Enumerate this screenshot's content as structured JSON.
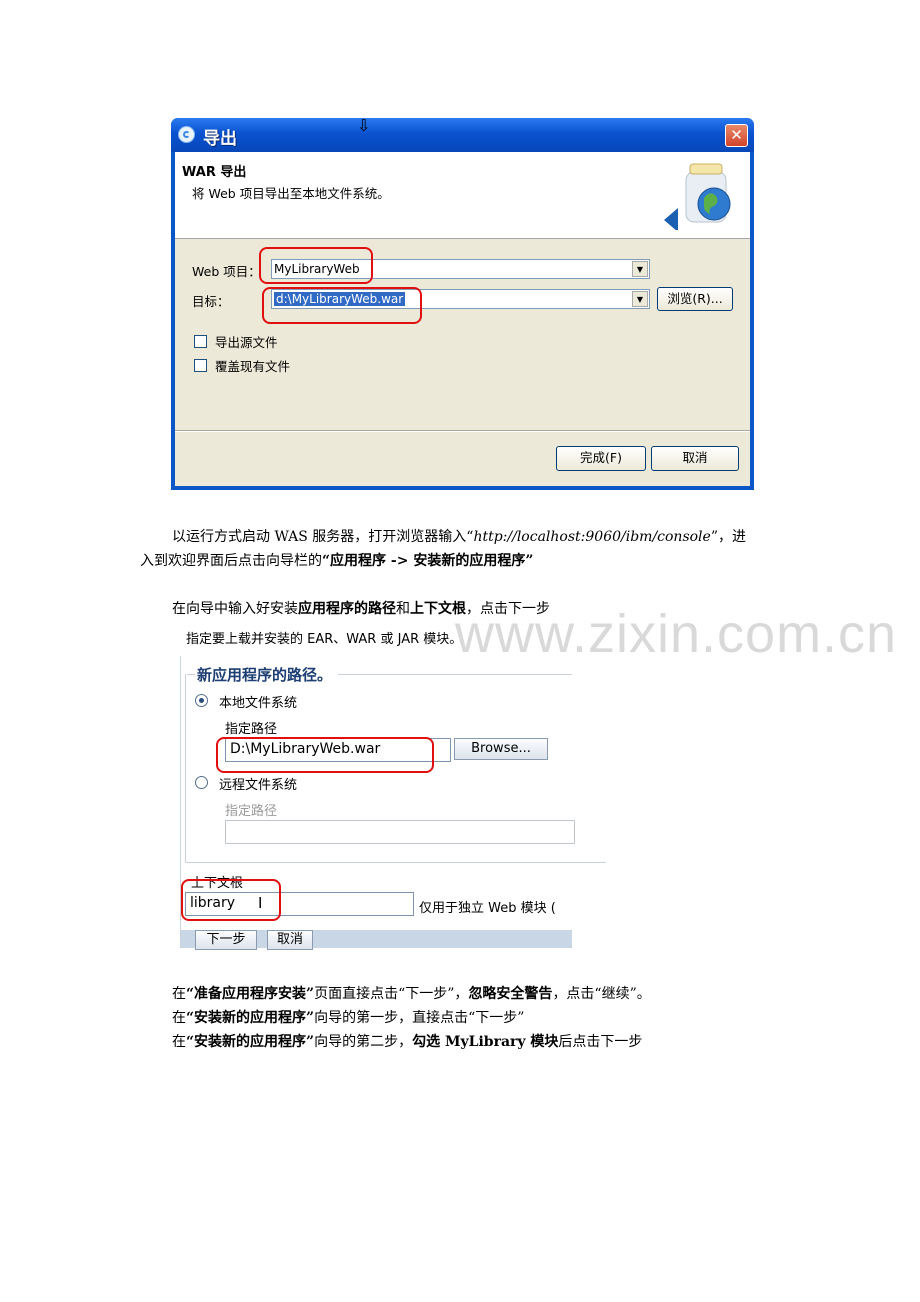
{
  "dialog": {
    "title": "导出",
    "close_label": "✕",
    "banner_title": "WAR 导出",
    "banner_desc": "将 Web 项目导出至本地文件系统。",
    "web_project_label": "Web 项目：",
    "web_project_value": "MyLibraryWeb",
    "target_label": "目标：",
    "target_value": "d:\\MyLibraryWeb.war",
    "browse_label": "浏览(R)...",
    "checkboxes": [
      "导出源文件",
      "覆盖现有文件"
    ],
    "finish_label": "完成(F)",
    "cancel_label": "取消"
  },
  "text": {
    "para1_a": "以运行方式启动 WAS 服务器，打开浏览器输入“",
    "para1_url": "http://localhost:9060/ibm/console",
    "para1_b": "”，进",
    "para2_a": "入到欢迎界面后点击向导栏的",
    "para2_b": "“应用程序 -> 安装新的应用程序”",
    "para3_a": "在向导中输入好安装",
    "para3_b": "应用程序的路径",
    "para3_c": "和",
    "para3_d": "上下文根",
    "para3_e": "，点击下一步",
    "line4_a": "在",
    "line4_b": "“准备应用程序安装”",
    "line4_c": "页面直接点击“下一步”，",
    "line4_d": "忽略安全警告",
    "line4_e": "，点击“继续”。",
    "line5_a": "在",
    "line5_b": "“安装新的应用程序”",
    "line5_c": "向导的第一步，直接点击“下一步”",
    "line6_a": "在",
    "line6_b": "“安装新的应用程序”",
    "line6_c": "向导的第二步，",
    "line6_d": "勾选 MyLibrary 模块",
    "line6_e": "后点击下一步",
    "watermark": "www.zixin.com.cn"
  },
  "was": {
    "caption": "指定要上载并安装的 EAR、WAR 或 JAR 模块。",
    "legend": "新应用程序的路径。",
    "local_label": "本地文件系统",
    "local_path_label": "指定路径",
    "local_path_value": "D:\\MyLibraryWeb.war",
    "browse_label": "Browse...",
    "remote_label": "远程文件系统",
    "remote_path_label": "指定路径",
    "context_root_label": "上下文根",
    "context_root_value": "library",
    "context_note": "仅用于独立 Web 模块 (",
    "next_label": "下一步",
    "cancel_label": "取消"
  },
  "colors": {
    "xp_title_blue": "#0a52d0",
    "dialog_bg": "#ece9d8",
    "highlight_red": "#e01010",
    "selection_blue": "#316ac5",
    "was_legend": "#1d3e72"
  }
}
